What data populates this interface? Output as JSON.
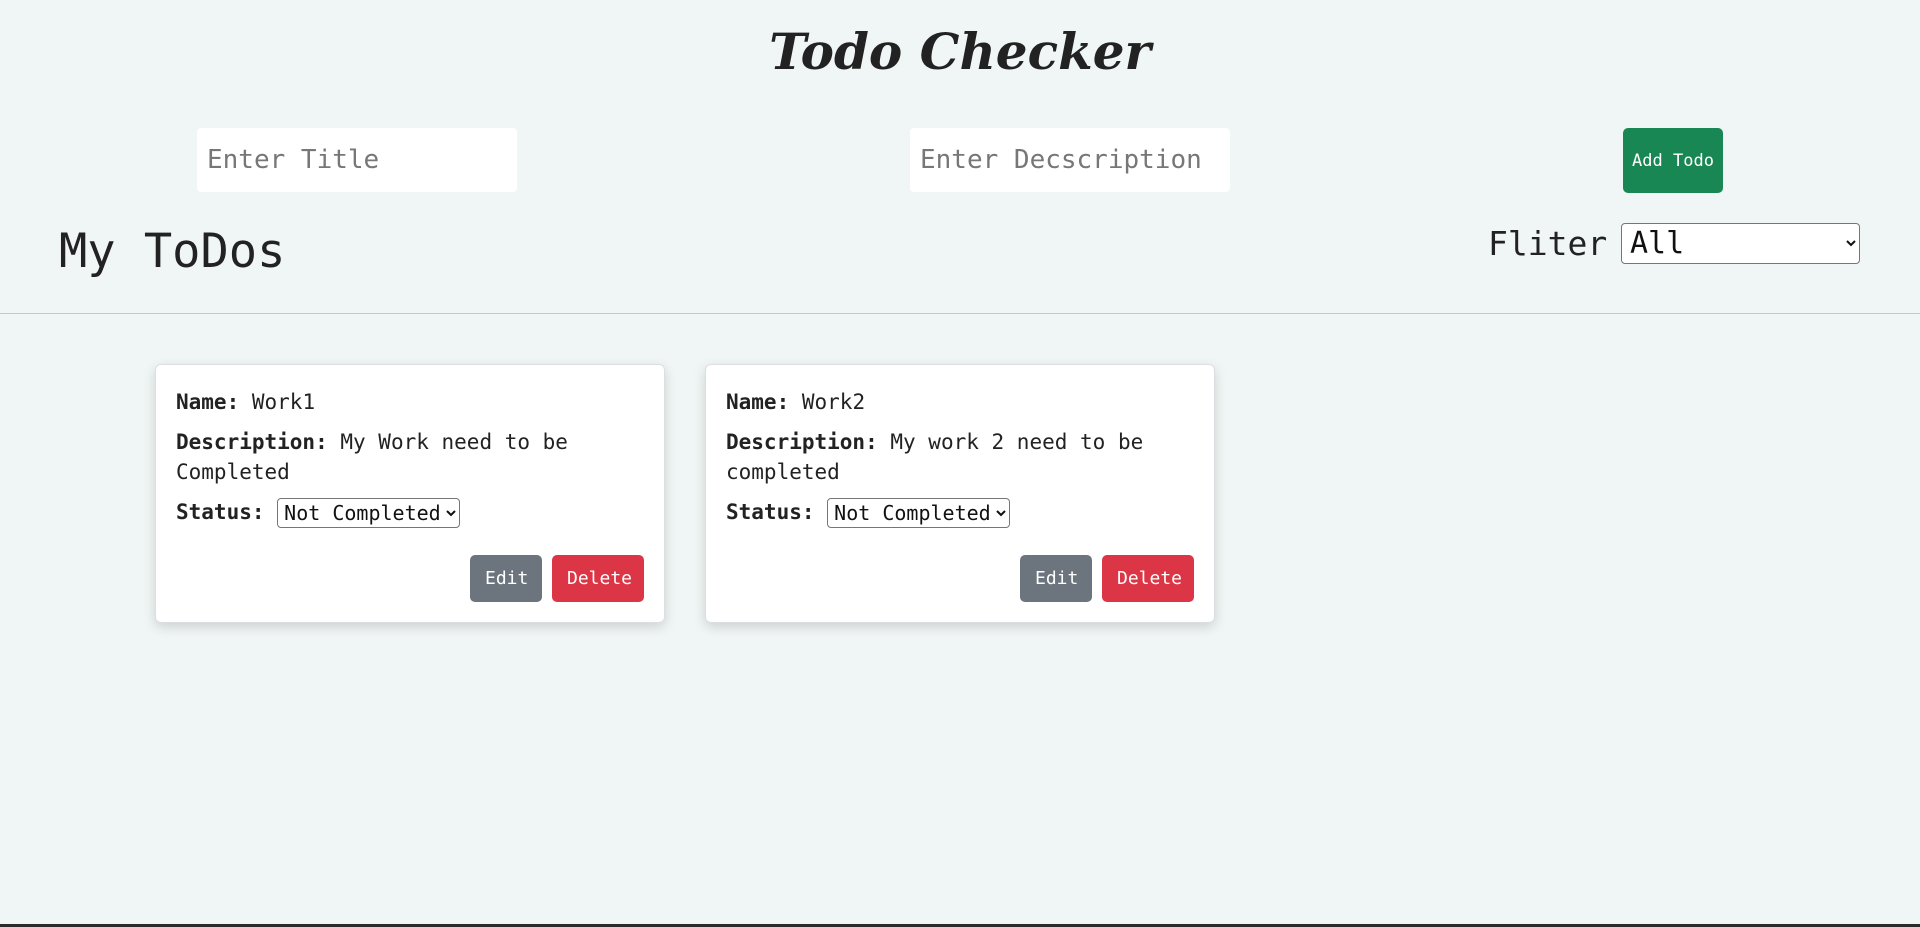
{
  "header": {
    "title": "Todo Checker"
  },
  "form": {
    "title_placeholder": "Enter Title",
    "description_placeholder": "Enter Decscription",
    "add_button_label": "Add Todo"
  },
  "list": {
    "heading": "My ToDos",
    "filter_label": "Fliter",
    "filter_selected": "All"
  },
  "labels": {
    "name": "Name:",
    "description": "Description:",
    "status": "Status:",
    "edit": "Edit",
    "delete": "Delete"
  },
  "todos": [
    {
      "name": "Work1",
      "description": "My Work need to be Completed",
      "status": "Not Completed"
    },
    {
      "name": "Work2",
      "description": "My work 2 need to be completed",
      "status": "Not Completed"
    }
  ],
  "colors": {
    "background": "#f0f6f5",
    "add_button": "#198754",
    "edit_button": "#6c757d",
    "delete_button": "#dc3545"
  }
}
